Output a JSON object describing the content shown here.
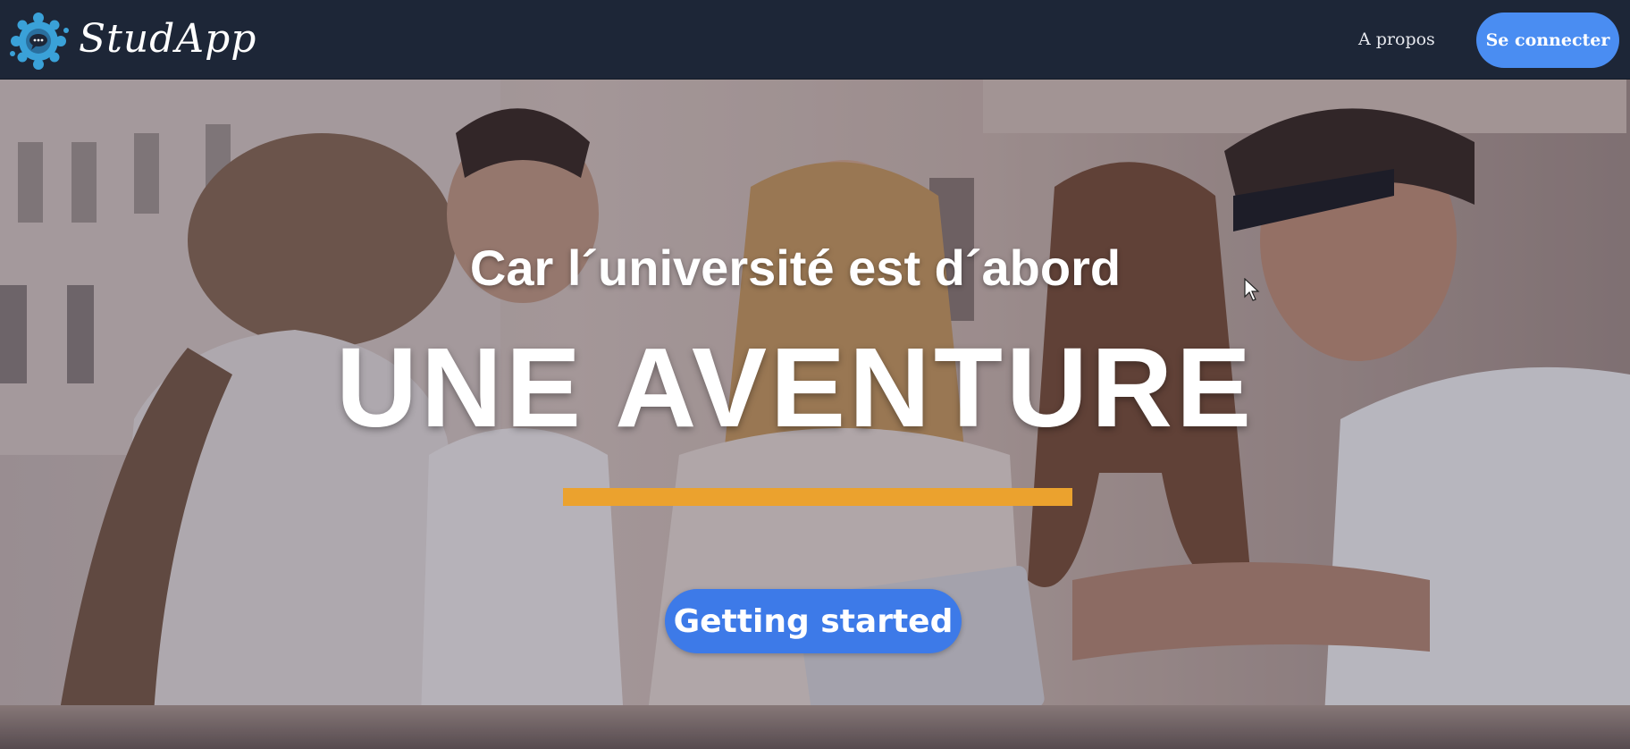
{
  "navbar": {
    "brand_name": "StudApp",
    "about_label": "A propos",
    "login_label": "Se connecter"
  },
  "hero": {
    "subtitle": "Car l´université est d´abord",
    "title": "UNE AVENTURE",
    "cta_label": "Getting started"
  },
  "colors": {
    "navbar_bg": "#1d2637",
    "primary_button": "#4a8df2",
    "accent_bar": "#eba22e",
    "hero_button": "#3d7ae8"
  },
  "icons": {
    "logo": "gear-chat-bubble-logo",
    "cursor": "mouse-pointer-icon"
  }
}
